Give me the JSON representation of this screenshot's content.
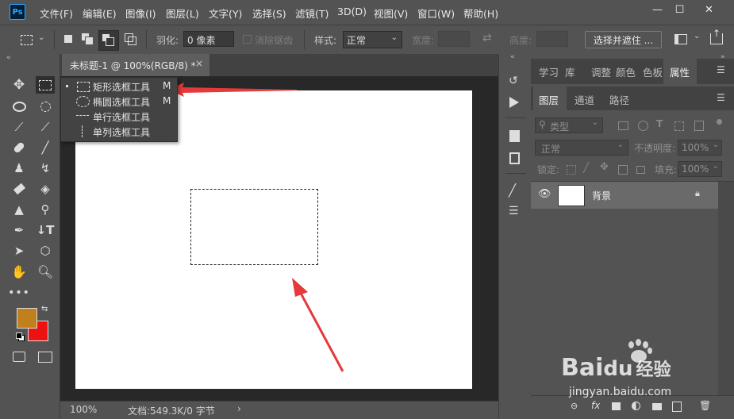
{
  "app": {
    "logo": "Ps",
    "accent": "#31a8ff"
  },
  "menu": [
    "文件(F)",
    "编辑(E)",
    "图像(I)",
    "图层(L)",
    "文字(Y)",
    "选择(S)",
    "滤镜(T)",
    "3D(D)",
    "视图(V)",
    "窗口(W)",
    "帮助(H)"
  ],
  "window_controls": {
    "minimize": "—",
    "maximize": "☐",
    "close": "✕"
  },
  "options": {
    "feather_label": "羽化:",
    "feather_value": "0 像素",
    "antialias_label": "消除锯齿",
    "style_label": "样式:",
    "style_value": "正常",
    "width_label": "宽度:",
    "height_label": "高度:",
    "select_mask_button": "选择并遮住 ..."
  },
  "document": {
    "tab_title": "未标题-1 @ 100%(RGB/8) *",
    "tab_close": "×",
    "canvas_color": "#ffffff"
  },
  "status": {
    "zoom": "100%",
    "doc_info": "文档:549.3K/0 字节",
    "arrow": "›"
  },
  "flyout": {
    "items": [
      {
        "label": "矩形选框工具",
        "shortcut": "M",
        "active": true
      },
      {
        "label": "椭圆选框工具",
        "shortcut": "M",
        "active": false
      },
      {
        "label": "单行选框工具",
        "shortcut": "",
        "active": false
      },
      {
        "label": "单列选框工具",
        "shortcut": "",
        "active": false
      }
    ]
  },
  "colors": {
    "foreground": "#c0801c",
    "background": "#ee1111"
  },
  "panel": {
    "top_tabs": [
      "学习",
      "库",
      "调整",
      "颜色",
      "色板",
      "属性"
    ],
    "layer_tabs": [
      "图层",
      "通道",
      "路径"
    ],
    "filter_label": "类型",
    "blend_mode": "正常",
    "opacity_label": "不透明度:",
    "opacity_value": "100%",
    "lock_label": "锁定:",
    "fill_label": "填充:",
    "fill_value": "100%",
    "layers": [
      {
        "name": "背景",
        "locked": true,
        "visible": true
      }
    ]
  },
  "watermark": {
    "brand": "Bai",
    "brand2": "du",
    "cn": "经验",
    "url": "jingyan.baidu.com"
  }
}
